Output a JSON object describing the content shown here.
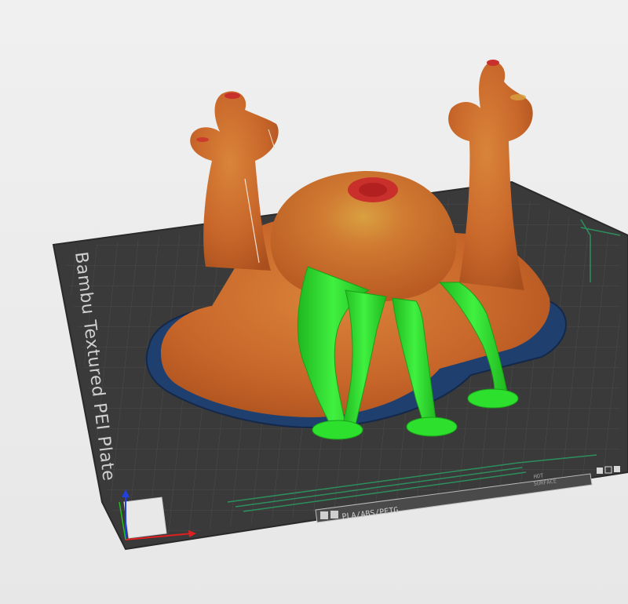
{
  "viewport": {
    "background": "#ececec"
  },
  "build_plate": {
    "name": "Bambu Textured PEI Plate",
    "filament_compat": "PLA/ABS/PETG",
    "surface_line1": "HOT",
    "surface_line2": "SURFACE",
    "plate_color": "#3a3a3a",
    "grid_color": "#4a4a4a",
    "accent_color": "#2d8f5e"
  },
  "model": {
    "body_color": "#c8662a",
    "highlight_color": "#d9a040",
    "overhang_color": "#c9302c",
    "brim_color": "#1f3f6e"
  },
  "supports": {
    "color": "#2ee02e"
  },
  "axes_gizmo": {
    "x_color": "#e02020",
    "y_color": "#20c020",
    "z_color": "#2040e0"
  }
}
